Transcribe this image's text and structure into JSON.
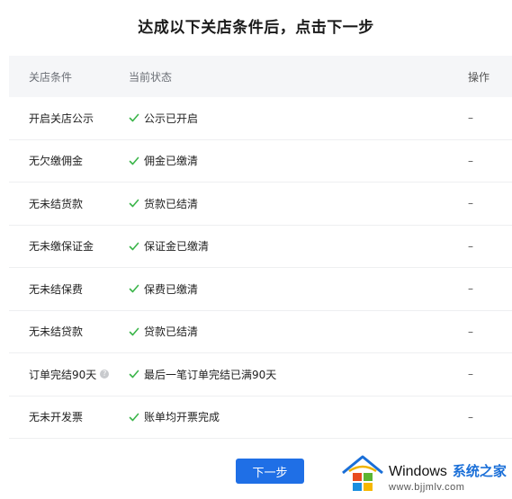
{
  "title": "达成以下关店条件后，点击下一步",
  "table": {
    "headers": [
      "关店条件",
      "当前状态",
      "操作"
    ],
    "rows": [
      {
        "condition": "开启关店公示",
        "status": "公示已开启",
        "action": "–"
      },
      {
        "condition": "无欠缴佣金",
        "status": "佣金已缴清",
        "action": "–"
      },
      {
        "condition": "无未结货款",
        "status": "货款已结清",
        "action": "–"
      },
      {
        "condition": "无未缴保证金",
        "status": "保证金已缴清",
        "action": "–"
      },
      {
        "condition": "无未结保费",
        "status": "保费已缴清",
        "action": "–"
      },
      {
        "condition": "无未结贷款",
        "status": "贷款已结清",
        "action": "–"
      },
      {
        "condition": "订单完结90天",
        "status": "最后一笔订单完结已满90天",
        "action": "–",
        "has_info_icon": true
      },
      {
        "condition": "无未开发票",
        "status": "账单均开票完成",
        "action": "–"
      }
    ]
  },
  "next_button": {
    "label": "下一步"
  },
  "watermark": {
    "brand": "Windows",
    "cn": "系统之家",
    "url": "www.bjjmlv.com"
  },
  "colors": {
    "primary": "#1f6fe6",
    "check": "#3bb54a",
    "header_bg": "#f5f6f8"
  },
  "icons": {
    "status": "check-icon",
    "info": "info-icon",
    "logo": "windows-house-logo"
  }
}
